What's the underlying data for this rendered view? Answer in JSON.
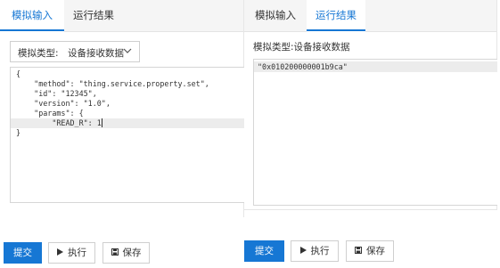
{
  "left": {
    "tabs": [
      {
        "label": "模拟输入",
        "active": true
      },
      {
        "label": "运行结果",
        "active": false
      }
    ],
    "select": {
      "label": "模拟类型:",
      "value": "设备接收数据"
    },
    "code_lines": [
      "{",
      "    \"method\": \"thing.service.property.set\",",
      "    \"id\": \"12345\",",
      "    \"version\": \"1.0\",",
      "    \"params\": {",
      "        \"READ_R\": 1",
      "}"
    ],
    "buttons": {
      "submit": "提交",
      "run": "执行",
      "save": "保存"
    }
  },
  "right": {
    "tabs": [
      {
        "label": "模拟输入",
        "active": false
      },
      {
        "label": "运行结果",
        "active": true
      }
    ],
    "result_label": "模拟类型:设备接收数据",
    "result_value": "\"0x010200000001b9ca\"",
    "buttons": {
      "submit": "提交",
      "run": "执行",
      "save": "保存"
    }
  },
  "icons": {
    "chevron": "chevron-down-icon",
    "play": "play-icon",
    "save": "save-icon"
  },
  "colors": {
    "accent": "#1677d4",
    "tab_bar": "#f5f5f5",
    "active_line": "#ececec"
  }
}
